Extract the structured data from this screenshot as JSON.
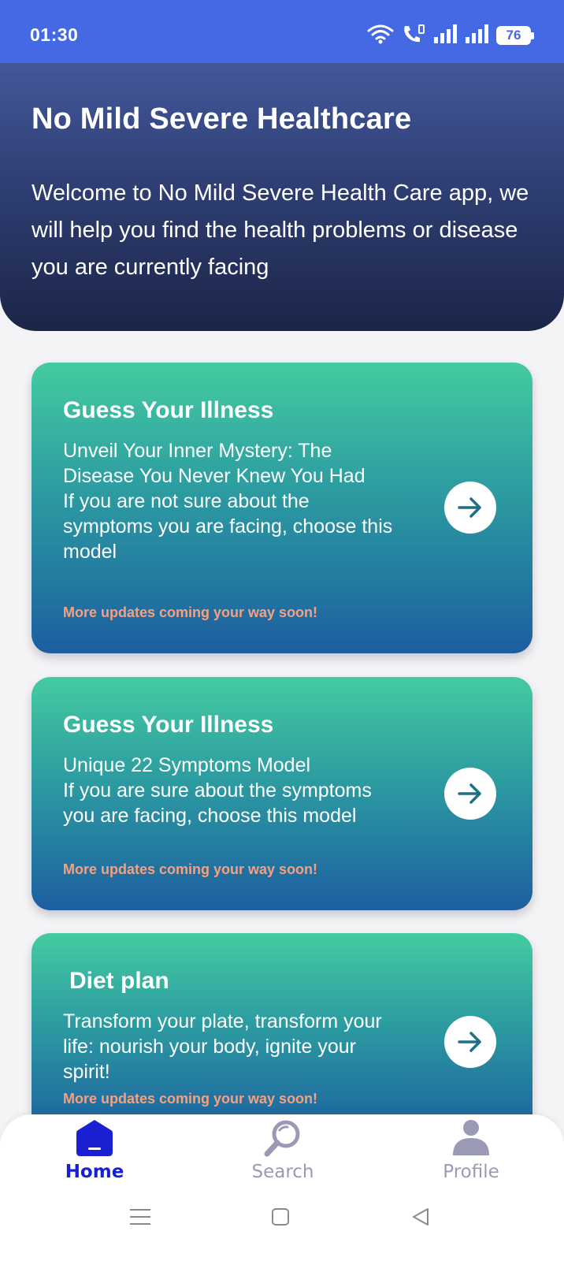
{
  "status_bar": {
    "time": "01:30",
    "battery": "76",
    "icons": [
      "wifi-icon",
      "call-icon",
      "signal-icon",
      "signal-icon",
      "battery-icon"
    ]
  },
  "header": {
    "title": "No Mild Severe Healthcare",
    "description": "Welcome to No Mild Severe Health Care app, we will help you find the health problems or disease you are currently facing"
  },
  "cards": [
    {
      "title": "Guess Your Illness",
      "body": "Unveil Your Inner Mystery: The Disease You Never Knew You Had\nIf you are not sure about the symptoms you are facing, choose this model",
      "note": "More updates coming your way soon!",
      "icon": "arrow-right-icon"
    },
    {
      "title": "Guess Your Illness",
      "body": "Unique 22 Symptoms Model\nIf you are sure about the symptoms you are facing, choose this model",
      "note": "More updates coming your way soon!",
      "icon": "arrow-right-icon"
    },
    {
      "title": "Diet plan",
      "body": "Transform your plate, transform your life: nourish your body, ignite your spirit!",
      "note": "More updates coming your way soon!",
      "icon": "arrow-right-icon"
    }
  ],
  "bottom_nav": {
    "items": [
      {
        "label": "Home",
        "icon": "home-icon",
        "active": true
      },
      {
        "label": "Search",
        "icon": "search-icon",
        "active": false
      },
      {
        "label": "Profile",
        "icon": "profile-icon",
        "active": false
      }
    ]
  },
  "colors": {
    "status_bar": "#4569e2",
    "header_top": "#43579a",
    "header_bottom": "#1b2548",
    "card_top": "#44cba1",
    "card_bottom": "#1c5ea0",
    "note_text": "#f7a07f",
    "nav_active": "#1a1fd1",
    "nav_inactive": "#9a9ab5"
  }
}
